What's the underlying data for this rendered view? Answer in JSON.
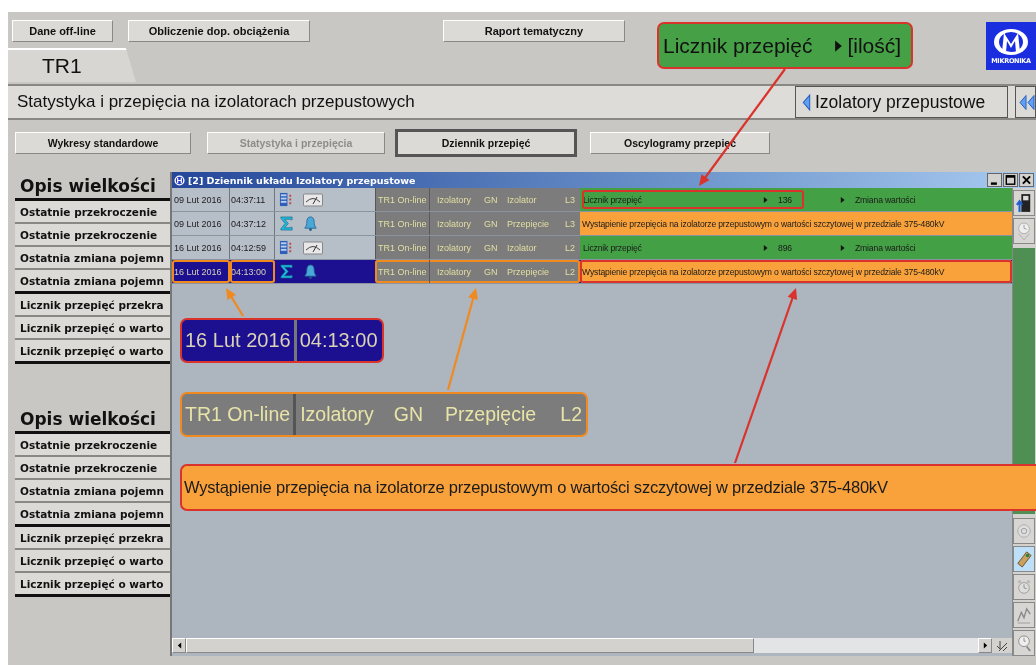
{
  "top_buttons": [
    {
      "label": "Dane off-line"
    },
    {
      "label": "Obliczenie dop. obciążenia"
    },
    {
      "label": "Raport tematyczny"
    }
  ],
  "logo": {
    "text": "MIKRONIKA"
  },
  "tab": {
    "label": "TR1"
  },
  "page_title": "Statystyka i przepięcia na izolatorach przepustowych",
  "nav_button": {
    "label": "Izolatory przepustowe"
  },
  "view_buttons": [
    {
      "label": "Wykresy standardowe",
      "selected": false,
      "disabled": false
    },
    {
      "label": "Statystyka i przepięcia",
      "selected": false,
      "disabled": true
    },
    {
      "label": "Dziennik przepięć",
      "selected": true,
      "disabled": false
    },
    {
      "label": "Oscylogramy przepięć",
      "selected": false,
      "disabled": false
    }
  ],
  "description_panels": [
    {
      "heading": "Opis wielkości",
      "groups": [
        [
          "Ostatnie przekroczenie",
          "Ostatnie przekroczenie",
          "Ostatnia zmiana pojemn",
          "Ostatnia zmiana pojemn"
        ],
        [
          "Licznik przepięć przekra",
          "Licznik przepięć o warto",
          "Licznik przepięć o warto"
        ]
      ]
    },
    {
      "heading": "Opis wielkości",
      "groups": [
        [
          "Ostatnie przekroczenie",
          "Ostatnie przekroczenie",
          "Ostatnia zmiana pojemn",
          "Ostatnia zmiana pojemn"
        ],
        [
          "Licznik przepięć przekra",
          "Licznik przepięć o warto",
          "Licznik przepięć o warto"
        ]
      ]
    }
  ],
  "log_window": {
    "title": "[2] Dziennik układu Izolatory przepustowe",
    "rows": [
      {
        "date": "09 Lut 2016",
        "time": "04:37:11",
        "kind": "counter",
        "selected": false,
        "annotated": true,
        "source": [
          "TR1 On-line",
          "Izolatory",
          "GN",
          "Izolator",
          "L3"
        ],
        "color": "#44a045",
        "message": "Licznik przepięć",
        "value": "136",
        "event": "Zmiana wartości"
      },
      {
        "date": "09 Lut 2016",
        "time": "04:37:12",
        "kind": "alarm",
        "selected": false,
        "annotated": false,
        "source": [
          "TR1 On-line",
          "Izolatory",
          "GN",
          "Przepięcie",
          "L3"
        ],
        "color": "#f9a23c",
        "message": "Wystąpienie przepięcia na izolatorze przepustowym o wartości szczytowej w przedziale 375-480kV"
      },
      {
        "date": "16 Lut 2016",
        "time": "04:12:59",
        "kind": "counter",
        "selected": false,
        "annotated": false,
        "source": [
          "TR1 On-line",
          "Izolatory",
          "GN",
          "Izolator",
          "L2"
        ],
        "color": "#44a045",
        "message": "Licznik przepięć",
        "value": "896",
        "event": "Zmiana wartości"
      },
      {
        "date": "16 Lut 2016",
        "time": "04:13:00",
        "kind": "alarm",
        "selected": true,
        "annotated": true,
        "source": [
          "TR1 On-line",
          "Izolatory",
          "GN",
          "Przepięcie",
          "L2"
        ],
        "color": "#f9a23c",
        "message": "Wystąpienie przepięcia na izolatorze przepustowym o wartości szczytowej w przedziale 375-480kV"
      }
    ]
  },
  "callouts": [
    {
      "kind": "counter",
      "label": "Licznik przepięć",
      "value": "[ilość]"
    },
    {
      "kind": "datetime",
      "parts": [
        "16 Lut 2016",
        "04:13:00"
      ]
    },
    {
      "kind": "source",
      "parts": [
        "TR1 On-line",
        "Izolatory",
        "GN",
        "Przepięcie",
        "L2"
      ]
    },
    {
      "kind": "message",
      "text": "Wystąpienie przepięcia na izolatorze przepustowym o wartości szczytowej w przedziale 375-480kV"
    }
  ]
}
